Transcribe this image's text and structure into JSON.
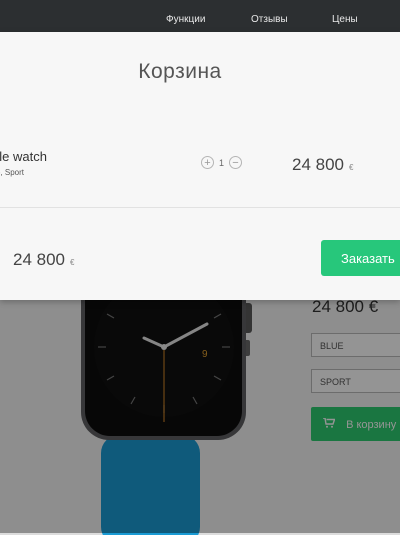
{
  "nav": {
    "items": [
      "Функции",
      "Отзывы",
      "Цены"
    ]
  },
  "product_page": {
    "price": "24 800 €",
    "color_select": "BLUE",
    "band_select": "SPORT",
    "add_to_cart_label": "В корзину",
    "watch_hour_digit": "9"
  },
  "cart_modal": {
    "title": "Корзина",
    "item": {
      "name": "ple watch",
      "options": "e, Sport",
      "quantity": "1",
      "price": "24 800",
      "currency": "€"
    },
    "total": {
      "price": "24 800",
      "currency": "€"
    },
    "order_button": "Заказать"
  },
  "colors": {
    "accent_green": "#27c77b",
    "band_blue": "#1a9bd4",
    "nav_bg": "#2c2f31"
  }
}
